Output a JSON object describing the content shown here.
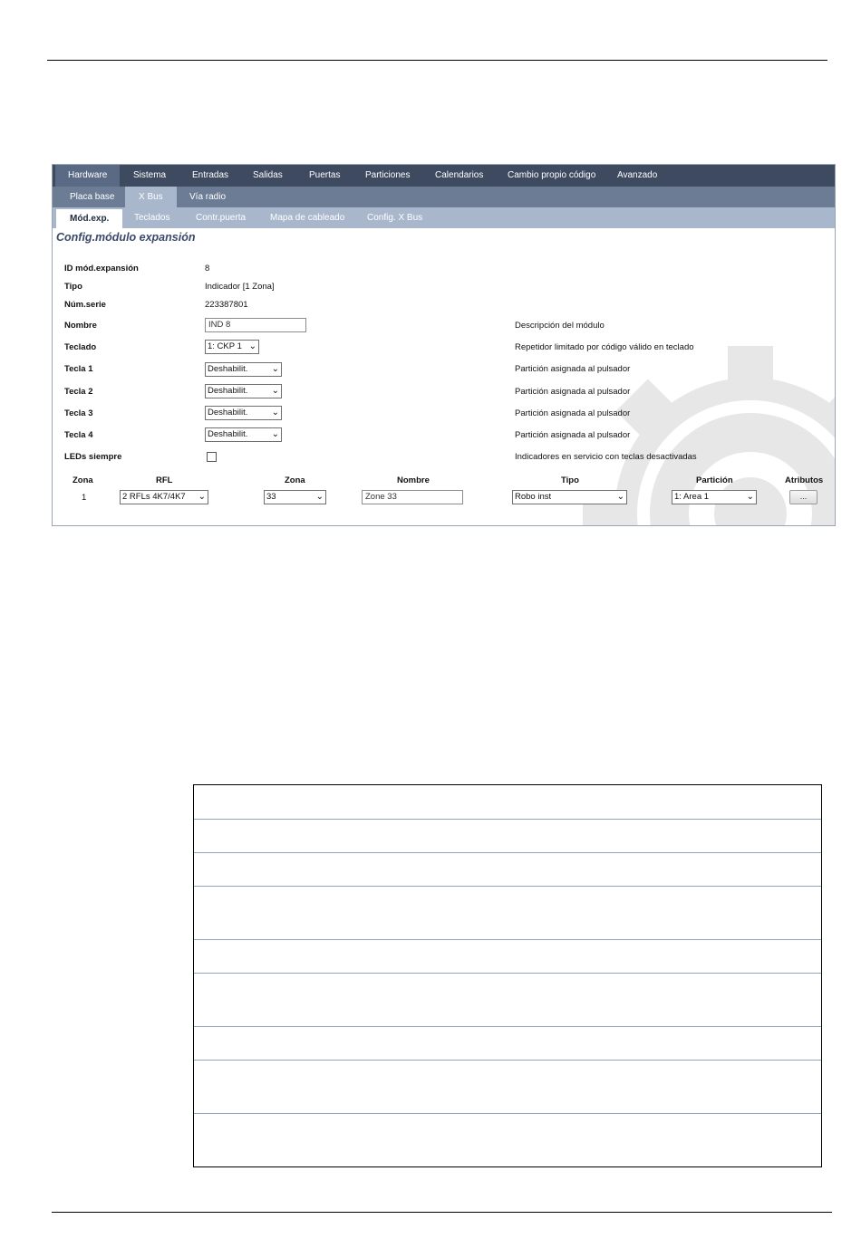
{
  "nav": {
    "main": [
      "Hardware",
      "Sistema",
      "Entradas",
      "Salidas",
      "Puertas",
      "Particiones",
      "Calendarios",
      "Cambio propio código",
      "Avanzado"
    ],
    "sub": [
      "Placa base",
      "X Bus",
      "Vía radio"
    ],
    "tabs": [
      "Mód.exp.",
      "Teclados",
      "Contr.puerta",
      "Mapa de cableado",
      "Config. X Bus"
    ]
  },
  "page_title": "Config.módulo expansión",
  "fields": {
    "id_label": "ID mód.expansión",
    "id_value": "8",
    "tipo_label": "Tipo",
    "tipo_value": "Indicador [1 Zona]",
    "serie_label": "Núm.serie",
    "serie_value": "223387801",
    "nombre_label": "Nombre",
    "nombre_value": "IND 8",
    "nombre_desc": "Descripción del módulo",
    "teclado_label": "Teclado",
    "teclado_value": "1: CKP 1",
    "teclado_desc": "Repetidor limitado por código válido en teclado",
    "tecla1_label": "Tecla 1",
    "tecla1_value": "Deshabilit.",
    "tecla1_desc": "Partición asignada al pulsador",
    "tecla2_label": "Tecla 2",
    "tecla2_value": "Deshabilit.",
    "tecla2_desc": "Partición asignada al pulsador",
    "tecla3_label": "Tecla 3",
    "tecla3_value": "Deshabilit.",
    "tecla3_desc": "Partición asignada al pulsador",
    "tecla4_label": "Tecla 4",
    "tecla4_value": "Deshabilit.",
    "tecla4_desc": "Partición asignada al pulsador",
    "leds_label": "LEDs siempre",
    "leds_checked": false,
    "leds_desc": "Indicadores en servicio con teclas desactivadas"
  },
  "zone_table": {
    "headers": [
      "Zona",
      "RFL",
      "Zona",
      "Nombre",
      "Tipo",
      "Partición",
      "Atributos"
    ],
    "row": {
      "zona": "1",
      "rfl": "2 RFLs 4K7/4K7",
      "zona_num": "33",
      "nombre": "Zone 33",
      "tipo": "Robo inst",
      "particion": "1: Area 1",
      "atributos": "..."
    }
  },
  "colors": {
    "nav_dark": "#3e4a5f",
    "nav_mid": "#6d7c95",
    "nav_light": "#a9b7cc",
    "title": "#3b4a6b"
  }
}
